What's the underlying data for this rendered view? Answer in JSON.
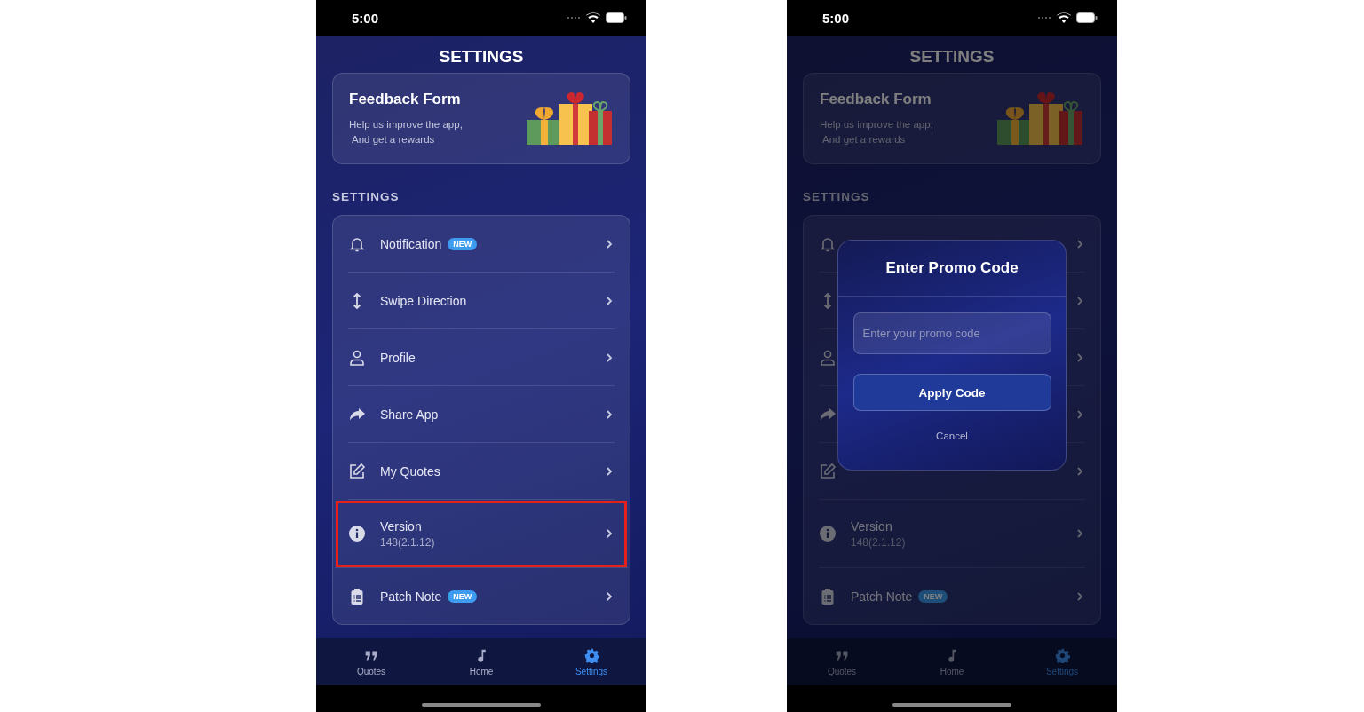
{
  "screens": [
    {
      "status_bar": {
        "time": "5:00"
      },
      "title": "SETTINGS",
      "dimmed": false,
      "feedback_card": {
        "title": "Feedback Form",
        "lines": [
          "Help us improve the app,",
          "And get a rewards"
        ]
      },
      "section_label": "SETTINGS",
      "settings_items": [
        {
          "label": "Notification",
          "badge": "NEW",
          "highlighted": false
        },
        {
          "label": "Swipe Direction",
          "highlighted": false
        },
        {
          "label": "Profile",
          "highlighted": false
        },
        {
          "label": "Share App",
          "highlighted": false
        },
        {
          "label": "My Quotes",
          "highlighted": false
        },
        {
          "label": "Version",
          "value": "148(2.1.12)",
          "highlighted": true
        },
        {
          "label": "Patch Note",
          "badge": "NEW",
          "highlighted": false
        }
      ],
      "tabs": [
        {
          "label": "Quotes",
          "selected": false
        },
        {
          "label": "Home",
          "selected": false
        },
        {
          "label": "Settings",
          "selected": true
        }
      ]
    },
    {
      "status_bar": {
        "time": "5:00"
      },
      "title": "SETTINGS",
      "dimmed": true,
      "feedback_card": {
        "title": "Feedback Form",
        "lines": [
          "Help us improve the app,",
          "And get a rewards"
        ]
      },
      "section_label": "SETTINGS",
      "settings_items": [
        {
          "highlighted": false
        },
        {
          "highlighted": false
        },
        {
          "highlighted": false
        },
        {
          "highlighted": false
        },
        {
          "highlighted": false
        },
        {
          "label": "Version",
          "value": "148(2.1.12)",
          "highlighted": false
        },
        {
          "label": "Patch Note",
          "badge": "NEW",
          "highlighted": false
        }
      ],
      "tabs": [
        {
          "label": "Quotes",
          "selected": false
        },
        {
          "label": "Home",
          "selected": false
        },
        {
          "label": "Settings",
          "selected": true
        }
      ],
      "dialog": {
        "title": "Enter Promo Code",
        "placeholder": "Enter your promo code",
        "apply_button": "Apply Code",
        "cancel_button": "Cancel"
      }
    }
  ]
}
